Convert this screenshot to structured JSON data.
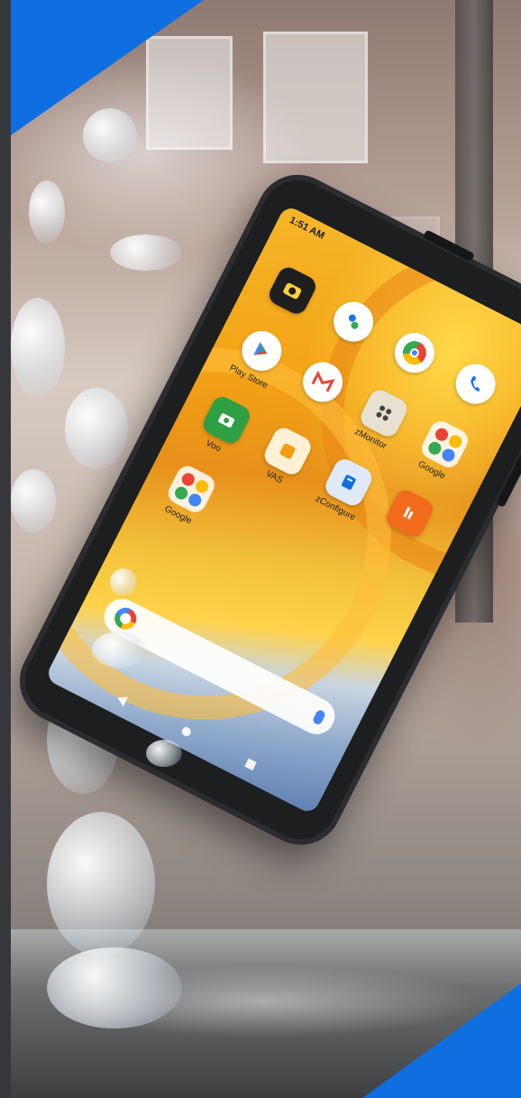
{
  "photo": {
    "subject": "",
    "background": ""
  },
  "phone_screen": {
    "status_time": "1:51 AM",
    "apps": [
      {
        "label": "",
        "icon": "camera-icon",
        "color": "#1f1f1f"
      },
      {
        "label": "",
        "icon": "google-pay-icon",
        "color": "#1a73e8"
      },
      {
        "label": "",
        "icon": "chrome-icon",
        "color": "#ea4335"
      },
      {
        "label": "",
        "icon": "phone-icon",
        "color": "#1a73e8"
      },
      {
        "label": "Play Store",
        "icon": "play-store-icon",
        "color": "#34a853"
      },
      {
        "label": "",
        "icon": "gmail-icon",
        "color": "#ea4335"
      },
      {
        "label": "zMonitor",
        "icon": "monitor-icon",
        "color": "#555555"
      },
      {
        "label": "Google",
        "icon": "google-folder-icon",
        "color": "#fbbc05"
      },
      {
        "label": "Voo",
        "icon": "voo-icon",
        "color": "#2ea043"
      },
      {
        "label": "VAS",
        "icon": "vas-icon",
        "color": "#f39c12"
      },
      {
        "label": "zConfigure",
        "icon": "configure-icon",
        "color": "#0f6fe0"
      },
      {
        "label": "",
        "icon": "orange-app-icon",
        "color": "#f26b1d"
      },
      {
        "label": "Google",
        "icon": "google-folder-icon",
        "color": "#fbbc05"
      }
    ],
    "search_bar": {
      "placeholder": "",
      "logo": "google-icon"
    }
  },
  "accents": {
    "brand_blue": "#0f6fe0"
  }
}
